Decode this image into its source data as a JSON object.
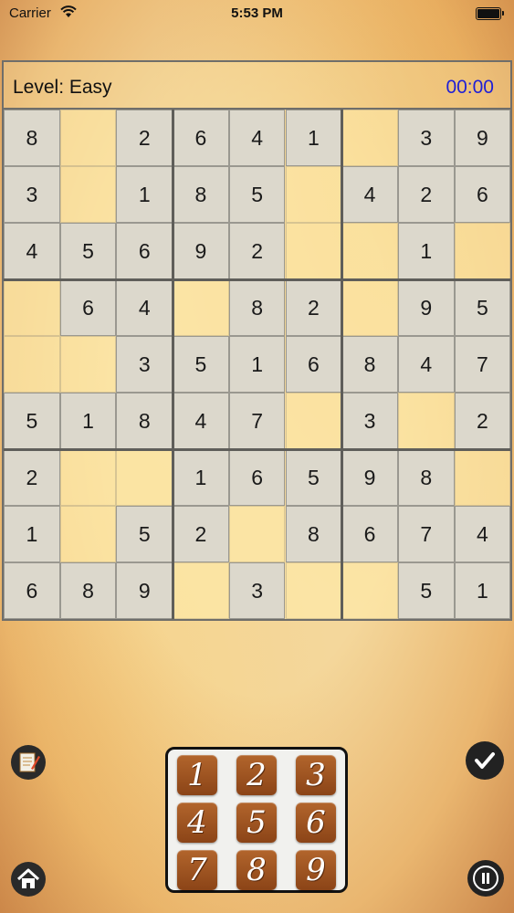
{
  "status": {
    "carrier": "Carrier",
    "time": "5:53 PM"
  },
  "game": {
    "level": "Level: Easy",
    "timer": "00:00"
  },
  "grid": [
    [
      "8",
      "",
      "2",
      "6",
      "4",
      "1",
      "",
      "3",
      "9"
    ],
    [
      "3",
      "",
      "1",
      "8",
      "5",
      "",
      "4",
      "2",
      "6"
    ],
    [
      "4",
      "5",
      "6",
      "9",
      "2",
      "",
      "",
      "1",
      ""
    ],
    [
      "",
      "6",
      "4",
      "",
      "8",
      "2",
      "",
      "9",
      "5"
    ],
    [
      "",
      "",
      "3",
      "5",
      "1",
      "6",
      "8",
      "4",
      "7"
    ],
    [
      "5",
      "1",
      "8",
      "4",
      "7",
      "",
      "3",
      "",
      "2"
    ],
    [
      "2",
      "",
      "",
      "1",
      "6",
      "5",
      "9",
      "8",
      ""
    ],
    [
      "1",
      "",
      "5",
      "2",
      "",
      "8",
      "6",
      "7",
      "4"
    ],
    [
      "6",
      "8",
      "9",
      "",
      "3",
      "",
      "",
      "5",
      "1"
    ]
  ],
  "keypad": [
    "1",
    "2",
    "3",
    "4",
    "5",
    "6",
    "7",
    "8",
    "9"
  ],
  "icons": {
    "notes": "notes-icon",
    "check": "check-icon",
    "home": "home-icon",
    "pause": "pause-icon"
  }
}
